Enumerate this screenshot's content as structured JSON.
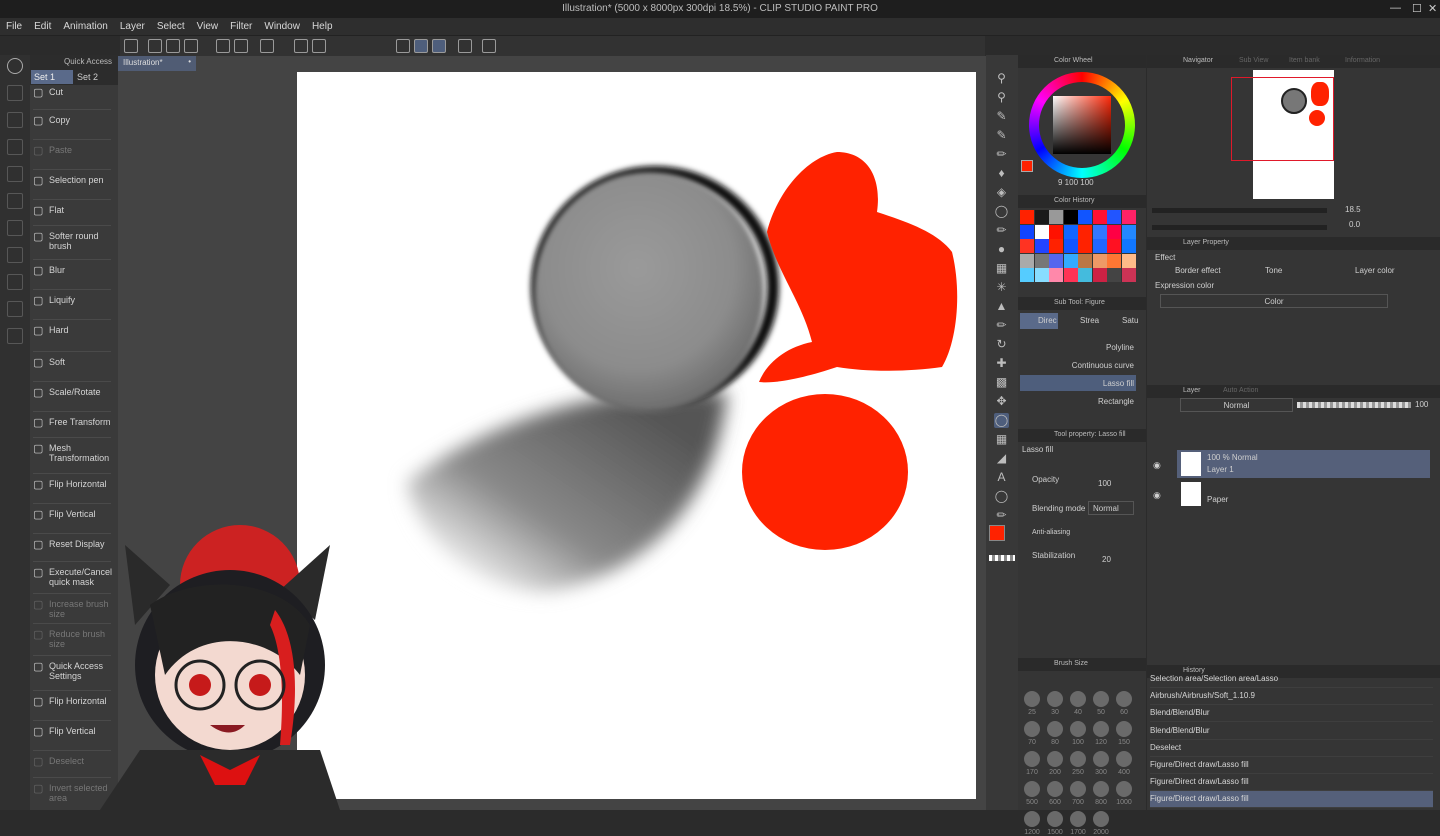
{
  "title": "Illustration* (5000 x 8000px 300dpi 18.5%)  - CLIP STUDIO PAINT PRO",
  "menu": [
    "File",
    "Edit",
    "Animation",
    "Layer",
    "Select",
    "View",
    "Filter",
    "Window",
    "Help"
  ],
  "quick_access": {
    "header": "Quick Access",
    "sets": [
      "Set 1",
      "Set 2"
    ],
    "items": [
      {
        "label": "Cut",
        "icon": "cut-icon",
        "enabled": true
      },
      {
        "label": "Copy",
        "icon": "copy-icon",
        "enabled": true
      },
      {
        "label": "Paste",
        "icon": "paste-icon",
        "enabled": false
      },
      {
        "label": "Selection pen",
        "icon": "selection-pen-icon",
        "enabled": true
      },
      {
        "label": "Flat",
        "icon": "flat-brush-icon",
        "enabled": true
      },
      {
        "label": "Softer round brush",
        "icon": "round-brush-icon",
        "enabled": true
      },
      {
        "label": "Blur",
        "icon": "blur-icon",
        "enabled": true
      },
      {
        "label": "Liquify",
        "icon": "liquify-icon",
        "enabled": true
      },
      {
        "label": "Hard",
        "icon": "hard-eraser-icon",
        "enabled": true
      },
      {
        "label": "Soft",
        "icon": "soft-eraser-icon",
        "enabled": true
      },
      {
        "label": "Scale/Rotate",
        "icon": "scale-rotate-icon",
        "enabled": true
      },
      {
        "label": "Free Transform",
        "icon": "free-transform-icon",
        "enabled": true
      },
      {
        "label": "Mesh Transformation",
        "icon": "mesh-transform-icon",
        "enabled": true
      },
      {
        "label": "Flip Horizontal",
        "icon": "flip-horizontal-icon",
        "enabled": true
      },
      {
        "label": "Flip Vertical",
        "icon": "flip-vertical-icon",
        "enabled": true
      },
      {
        "label": "Reset Display",
        "icon": "reset-display-icon",
        "enabled": true
      },
      {
        "label": "Execute/Cancel quick mask",
        "icon": "quick-mask-icon",
        "enabled": true
      },
      {
        "label": "Increase brush size",
        "icon": "increase-brush-icon",
        "enabled": false
      },
      {
        "label": "Reduce brush size",
        "icon": "reduce-brush-icon",
        "enabled": false
      },
      {
        "label": "Quick Access Settings",
        "icon": "settings-icon",
        "enabled": true
      },
      {
        "label": "Flip Horizontal",
        "icon": "flip-horizontal-icon",
        "enabled": true
      },
      {
        "label": "Flip Vertical",
        "icon": "flip-vertical-icon",
        "enabled": true
      },
      {
        "label": "Deselect",
        "icon": "deselect-icon",
        "enabled": false
      },
      {
        "label": "Invert selected area",
        "icon": "invert-selection-icon",
        "enabled": false
      }
    ]
  },
  "doc_tab": "Illustration*",
  "color_wheel": {
    "header": "Color Wheel",
    "values": "9  100  100",
    "main_color": "#ff2a0a"
  },
  "color_history": {
    "header": "Color History",
    "colors": [
      "#ff2200",
      "#1a1a1a",
      "#999999",
      "#000000",
      "#1155ff",
      "#ff1133",
      "#2255ff",
      "#ff2266",
      "#1144ff",
      "#ffffff",
      "#ff1100",
      "#1166ff",
      "#ff2200",
      "#3377ff",
      "#ff0044",
      "#2288ff",
      "#ff3322",
      "#2244ff",
      "#ff2200",
      "#1155ff",
      "#ff2200",
      "#2266ff",
      "#ff1122",
      "#1177ff",
      "#aaaaaa",
      "#777777",
      "#5566ee",
      "#33aaff",
      "#bb7744",
      "#ee9966",
      "#ff7733",
      "#ffbb88",
      "#55ccff",
      "#88ddff",
      "#ff88aa",
      "#ff3355",
      "#44bbdd",
      "#cc2244",
      "#444444",
      "#cc3355"
    ]
  },
  "subtool": {
    "header": "Sub Tool: Figure",
    "tabs": [
      "Direc",
      "Strea",
      "Satu"
    ],
    "items": [
      "Polyline",
      "Continuous curve",
      "Lasso fill",
      "Rectangle"
    ]
  },
  "tool_property": {
    "header": "Tool property: Lasso fill",
    "name": "Lasso fill",
    "opacity_label": "Opacity",
    "opacity": "100",
    "blend_label": "Blending mode",
    "blend": "Normal",
    "aa_label": "Anti-aliasing",
    "stab_label": "Stabilization",
    "stab": "20"
  },
  "brush_size": {
    "header": "Brush Size",
    "sizes": [
      "25",
      "30",
      "40",
      "50",
      "60",
      "70",
      "80",
      "100",
      "120",
      "150",
      "170",
      "200",
      "250",
      "300",
      "400",
      "500",
      "600",
      "700",
      "800",
      "1000",
      "1200",
      "1500",
      "1700",
      "2000"
    ]
  },
  "navigator": {
    "tabs": [
      "Navigator",
      "Sub View",
      "Item bank",
      "Information"
    ],
    "zoom": "18.5",
    "angle": "0.0"
  },
  "layer_property": {
    "header": "Layer Property",
    "effect_label": "Effect",
    "effects": [
      "Border effect",
      "Tone",
      "Layer color"
    ],
    "expression_label": "Expression color",
    "expression": "Color"
  },
  "layer_panel": {
    "tabs": [
      "Layer",
      "Auto Action"
    ],
    "blend": "Normal",
    "opacity": "100",
    "layers": [
      {
        "mode": "100 % Normal",
        "name": "Layer 1",
        "selected": true
      },
      {
        "mode": "",
        "name": "Paper",
        "selected": false
      }
    ]
  },
  "history": {
    "header": "History",
    "items": [
      "Selection area/Selection area/Lasso",
      "Airbrush/Airbrush/Soft_1.10.9",
      "Blend/Blend/Blur",
      "Blend/Blend/Blur",
      "Deselect",
      "Figure/Direct draw/Lasso fill",
      "Figure/Direct draw/Lasso fill",
      "Figure/Direct draw/Lasso fill"
    ]
  }
}
